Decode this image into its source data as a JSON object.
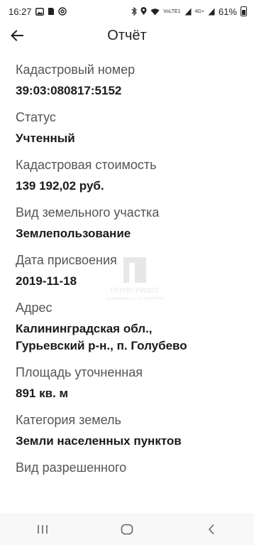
{
  "status_bar": {
    "time": "16:27",
    "network_lte1": "VoLTE1",
    "network_4g": "4G+",
    "battery": "61%"
  },
  "header": {
    "title": "Отчёт"
  },
  "fields": [
    {
      "label": "Кадастровый номер",
      "value": "39:03:080817:5152"
    },
    {
      "label": "Статус",
      "value": "Учтенный"
    },
    {
      "label": "Кадастровая стоимость",
      "value": "139 192,02 руб."
    },
    {
      "label": "Вид земельного участка",
      "value": "Землепользование"
    },
    {
      "label": "Дата присвоения",
      "value": "2019-11-18"
    },
    {
      "label": "Адрес",
      "value_lines": [
        "Калининградская обл.,",
        "Гурьевский р-н., п. Голубево"
      ]
    },
    {
      "label": "Площадь уточненная",
      "value": "891 кв. м"
    },
    {
      "label": "Категория земель",
      "value": "Земли населенных пунктов"
    },
    {
      "label": "Вид разрешенного"
    }
  ],
  "watermark": {
    "text": "ГРУПП РИЭЛТ",
    "subtext": "НЕДВИЖИМОСТЬ ОТ ЭКСПЕРТОВ"
  },
  "nav_bar": {
    "icons": [
      "recent-apps-icon",
      "home-icon",
      "back-nav-icon"
    ]
  },
  "colors": {
    "background": "#ffffff",
    "text_primary": "#1f1f1f",
    "text_secondary": "#555555",
    "nav_bar": "#f8f8f8"
  }
}
